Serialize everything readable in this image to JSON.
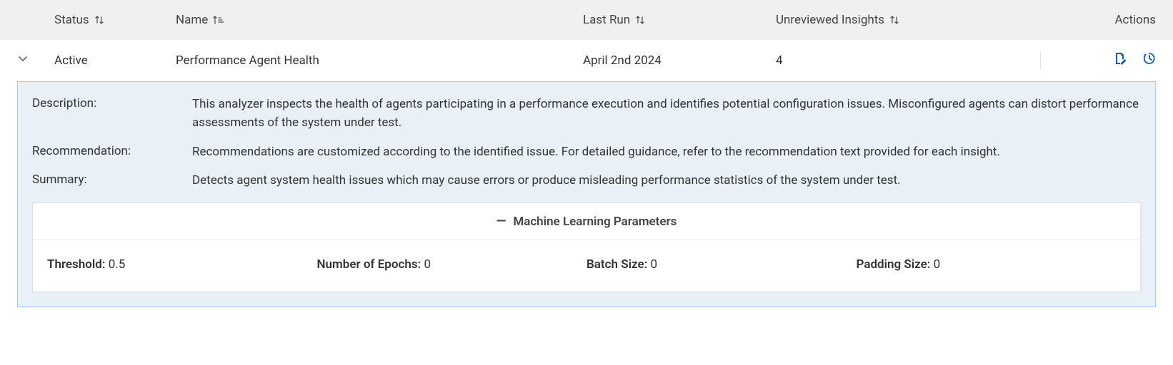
{
  "columns": {
    "status": "Status",
    "name": "Name",
    "last_run": "Last Run",
    "insights": "Unreviewed Insights",
    "actions": "Actions"
  },
  "row": {
    "status": "Active",
    "name": "Performance Agent Health",
    "last_run": "April 2nd 2024",
    "insights": "4"
  },
  "detail": {
    "description_label": "Description:",
    "description": "This analyzer inspects the health of agents participating in a performance execution and identifies potential configuration issues. Misconfigured agents can distort performance assessments of the system under test.",
    "recommendation_label": "Recommendation:",
    "recommendation": "Recommendations are customized according to the identified issue. For detailed guidance, refer to the recommendation text provided for each insight.",
    "summary_label": "Summary:",
    "summary": "Detects agent system health issues which may cause errors or produce misleading performance statistics of the system under test."
  },
  "ml": {
    "title": "Machine Learning Parameters",
    "threshold_label": "Threshold:",
    "threshold_value": "0.5",
    "epochs_label": "Number of Epochs:",
    "epochs_value": "0",
    "batch_label": "Batch Size:",
    "batch_value": "0",
    "padding_label": "Padding Size:",
    "padding_value": "0"
  }
}
